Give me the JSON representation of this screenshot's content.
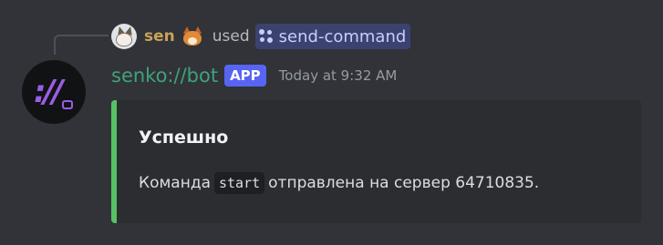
{
  "reply": {
    "user_name": "sen",
    "used_label": "used",
    "command_name": "send-command"
  },
  "message": {
    "bot_name": "senko://bot",
    "badge": "APP",
    "timestamp": "Today at 9:32 AM"
  },
  "embed": {
    "title": "Успешно",
    "desc_before": "Команда",
    "desc_code": "start",
    "desc_after": "отправлена на сервер 64710835.",
    "accent_color": "#57c264"
  },
  "icons": {
    "reply_avatar": "fox-avatar-icon",
    "reply_emoji": "fox-emoji-icon",
    "command": "slash-command-icon",
    "bot_avatar": "bot-logo-icon"
  },
  "colors": {
    "background": "#313338",
    "bot_name": "#3fa27a",
    "app_badge": "#5865f2",
    "reply_name": "#c8a35a",
    "command_pill": "#3c4270"
  }
}
